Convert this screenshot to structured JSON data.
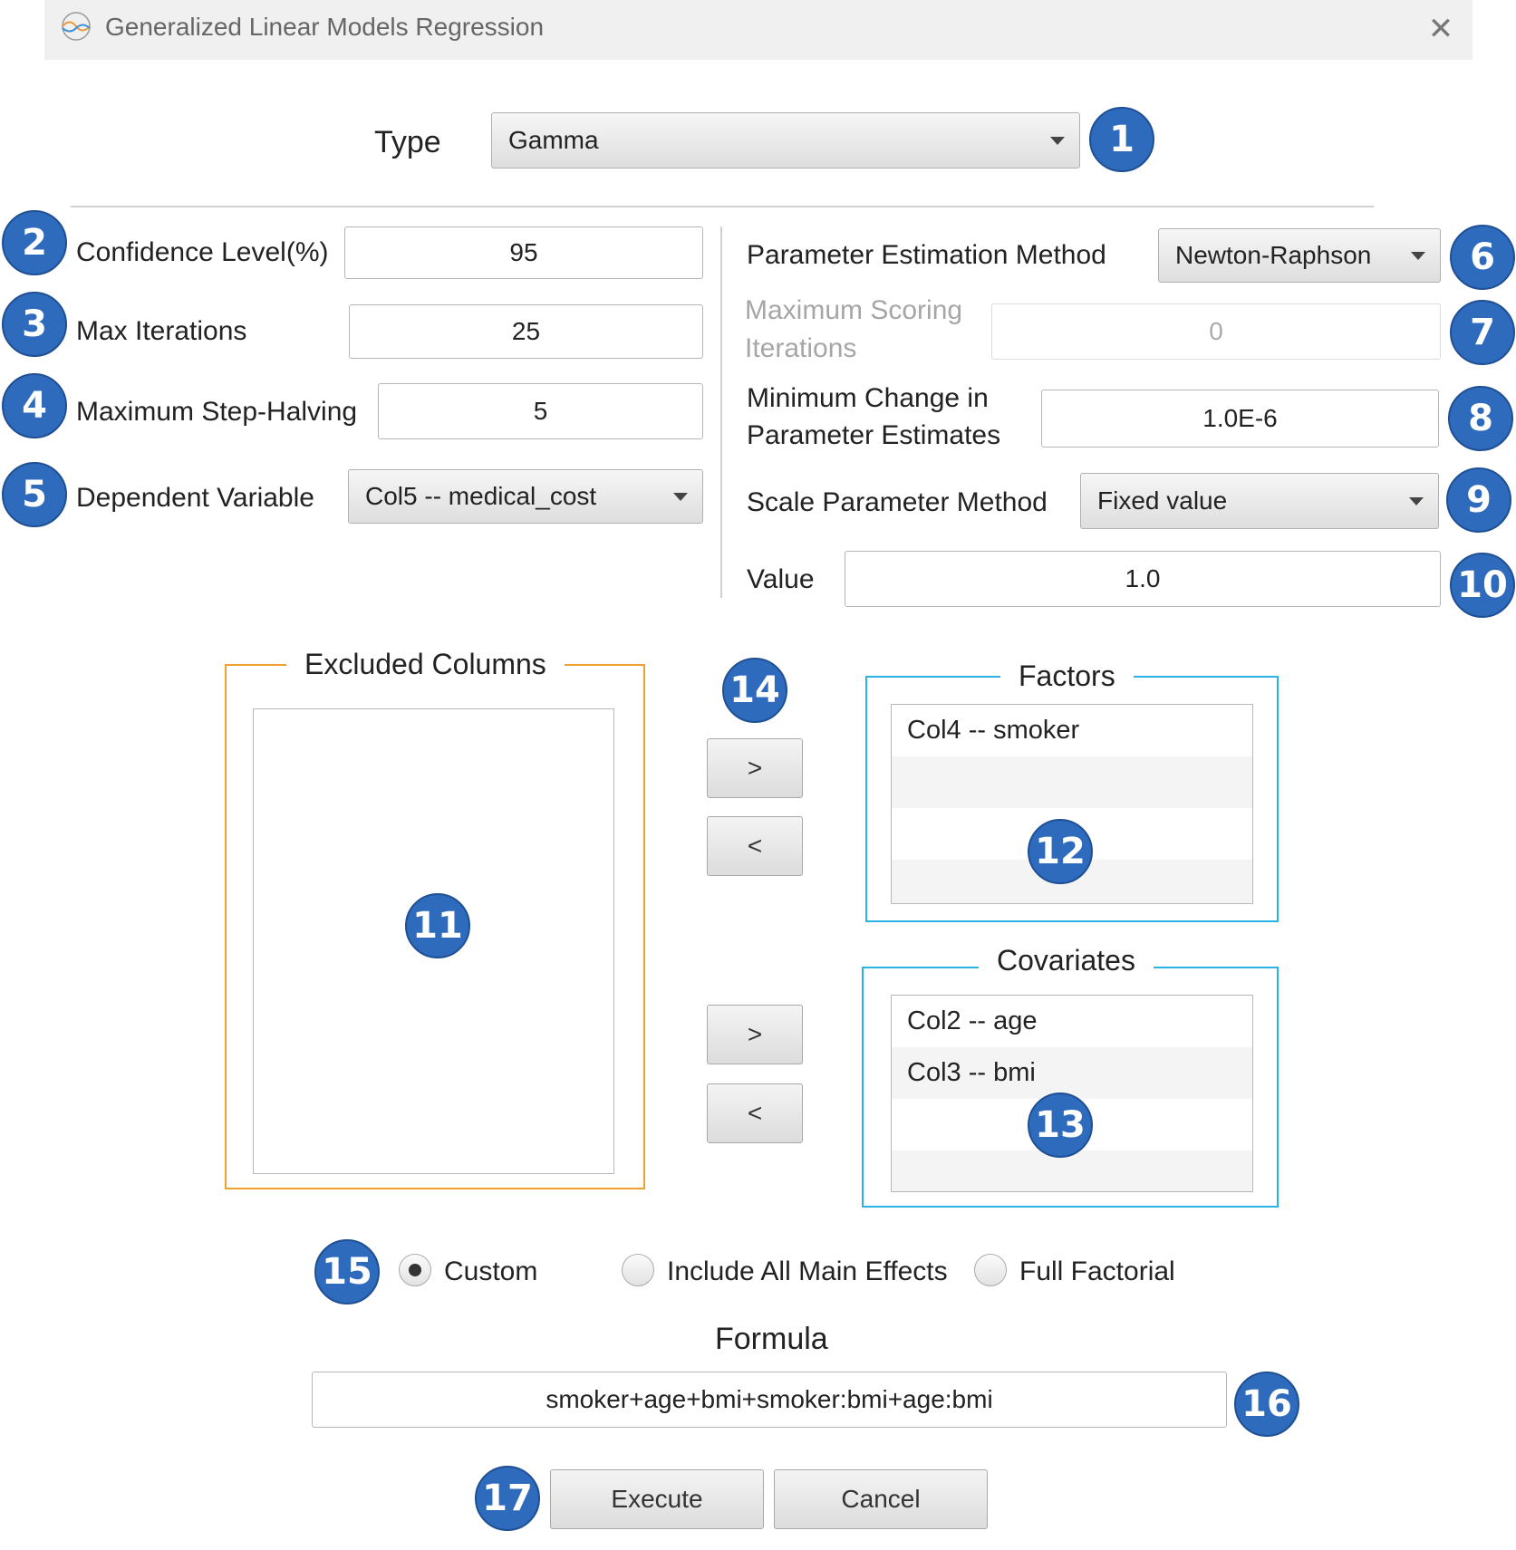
{
  "window": {
    "title": "Generalized Linear Models Regression",
    "close_icon": "close-icon"
  },
  "type": {
    "label": "Type",
    "value": "Gamma"
  },
  "left": {
    "confidence": {
      "label": "Confidence Level(%)",
      "value": "95"
    },
    "max_iterations": {
      "label": "Max Iterations",
      "value": "25"
    },
    "step_halving": {
      "label": "Maximum Step-Halving",
      "value": "5"
    },
    "dependent": {
      "label": "Dependent Variable",
      "value": "Col5 -- medical_cost"
    }
  },
  "right": {
    "estimation": {
      "label": "Parameter Estimation Method",
      "value": "Newton-Raphson"
    },
    "scoring": {
      "label_line1": "Maximum Scoring",
      "label_line2": "Iterations",
      "value": "0"
    },
    "min_change": {
      "label_line1": "Minimum Change in",
      "label_line2": "Parameter Estimates",
      "value": "1.0E-6"
    },
    "scale": {
      "label": "Scale Parameter Method",
      "value": "Fixed value"
    },
    "value": {
      "label": "Value",
      "value": "1.0"
    }
  },
  "excluded": {
    "title": "Excluded Columns",
    "items": [],
    "border_color": "#f0a030"
  },
  "factors": {
    "title": "Factors",
    "items": [
      "Col4 -- smoker"
    ],
    "border_color": "#2ab4e6"
  },
  "covariates": {
    "title": "Covariates",
    "items": [
      "Col2 -- age",
      "Col3 -- bmi"
    ],
    "border_color": "#2ab4e6"
  },
  "move_buttons": {
    "right": ">",
    "left": "<"
  },
  "model": {
    "options": [
      "Custom",
      "Include All Main Effects",
      "Full Factorial"
    ],
    "selected": "Custom"
  },
  "formula": {
    "label": "Formula",
    "value": "smoker+age+bmi+smoker:bmi+age:bmi"
  },
  "actions": {
    "execute": "Execute",
    "cancel": "Cancel"
  },
  "callouts": [
    "1",
    "2",
    "3",
    "4",
    "5",
    "6",
    "7",
    "8",
    "9",
    "10",
    "11",
    "12",
    "13",
    "14",
    "15",
    "16",
    "17"
  ],
  "colors": {
    "callout": "#2e6bbd"
  }
}
